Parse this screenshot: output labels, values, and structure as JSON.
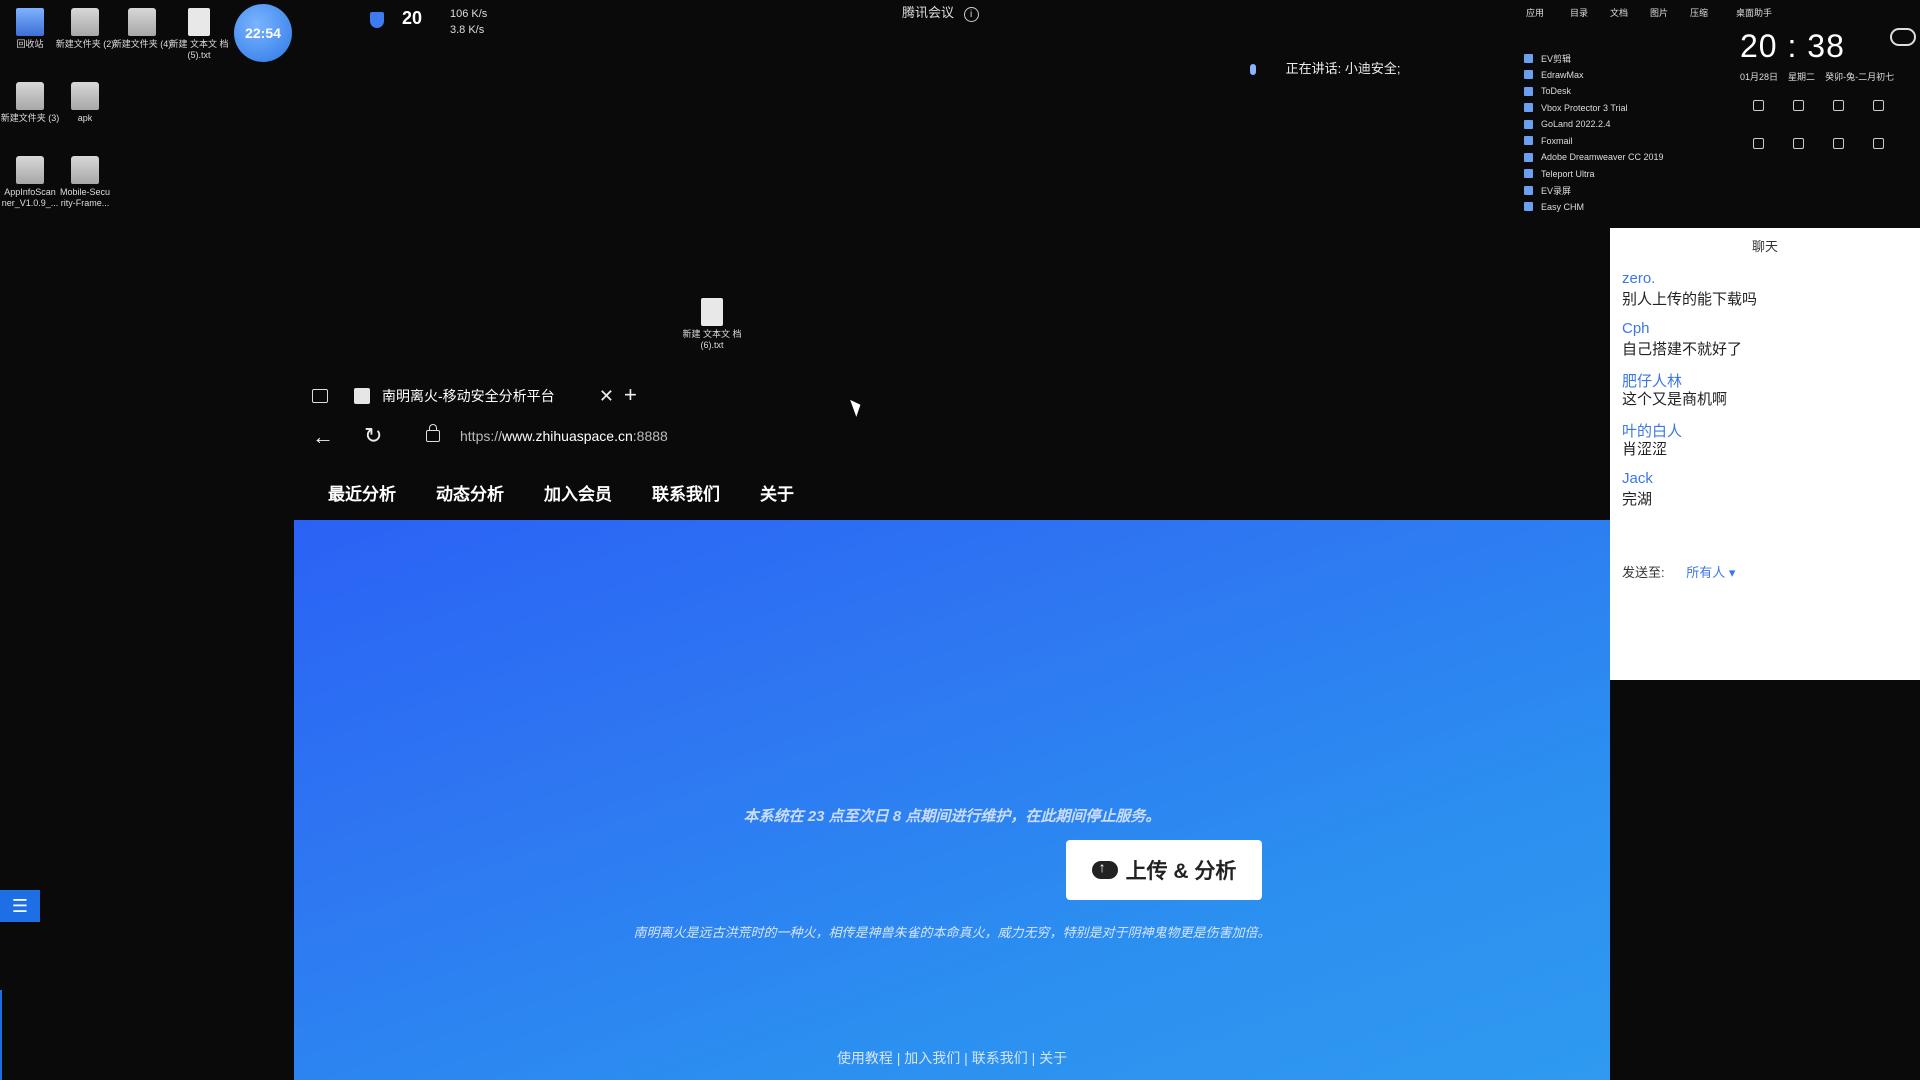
{
  "desktop": {
    "icons": [
      {
        "label": "回收站"
      },
      {
        "label": "新建文件夹 (2)"
      },
      {
        "label": "新建文件夹 (4)"
      },
      {
        "label": "新建 文本文 档 (5).txt"
      },
      {
        "label": "新建文件夹 (3)"
      },
      {
        "label": "apk"
      },
      {
        "label": "AppInfoScan ner_V1.0.9_..."
      },
      {
        "label": "Mobile-Secu rity-Frame..."
      },
      {
        "label": "新建 文本文 档 (6).txt"
      }
    ],
    "clock_bubble": "22:54"
  },
  "net_widget": {
    "temp": "20",
    "up": "106 K/s",
    "down": "3.8 K/s"
  },
  "meeting": {
    "app_name": "腾讯会议",
    "info_glyph": "i",
    "speaking": "正在讲话: 小迪安全;"
  },
  "app_panel": {
    "tabs": [
      "应用",
      "目录",
      "文档",
      "图片",
      "压缩"
    ],
    "apps": [
      "EV剪辑",
      "EdrawMax",
      "ToDesk",
      "Vbox Protector 3 Trial",
      "GoLand 2022.2.4",
      "Foxmail",
      "Adobe Dreamweaver CC 2019",
      "Teleport Ultra",
      "EV录屏",
      "Easy CHM"
    ]
  },
  "clock_panel": {
    "title": "桌面助手",
    "time": "20 : 38",
    "date": "01月28日",
    "weekday": "星期二",
    "lunar": "癸卯-兔-二月初七"
  },
  "browser": {
    "tab_title": "南明离火-移动安全分析平台",
    "url_prefix": "https://",
    "url_host": "www.zhihuaspace.cn",
    "url_port": ":8888",
    "nav": [
      "最近分析",
      "动态分析",
      "加入会员",
      "联系我们",
      "关于"
    ],
    "notice": "本系统在 23 点至次日 8 点期间进行维护，在此期间停止服务。",
    "upload_label": "上传 & 分析",
    "description": "南明离火是远古洪荒时的一种火，相传是神兽朱雀的本命真火，威力无穷，特别是对于阴神鬼物更是伤害加倍。",
    "footer": "使用教程 | 加入我们 | 联系我们 | 关于"
  },
  "chat": {
    "header": "聊天",
    "messages": [
      {
        "name": "zero.",
        "text": "别人上传的能下载吗"
      },
      {
        "name": "Cph",
        "text": "自己搭建不就好了"
      },
      {
        "name": "肥仔人林",
        "text": "这个又是商机啊"
      },
      {
        "name": "叶的白人",
        "text": "肖涩涩"
      },
      {
        "name": "Jack",
        "text": "完湖"
      }
    ],
    "send_to_label": "发送至:",
    "send_to_value": "所有人 ▾"
  },
  "colors": {
    "hero_start": "#2a62f5",
    "hero_end": "#2f9af0",
    "chat_name": "#3b78e7",
    "taskbar_accent": "#1e6fe6"
  }
}
